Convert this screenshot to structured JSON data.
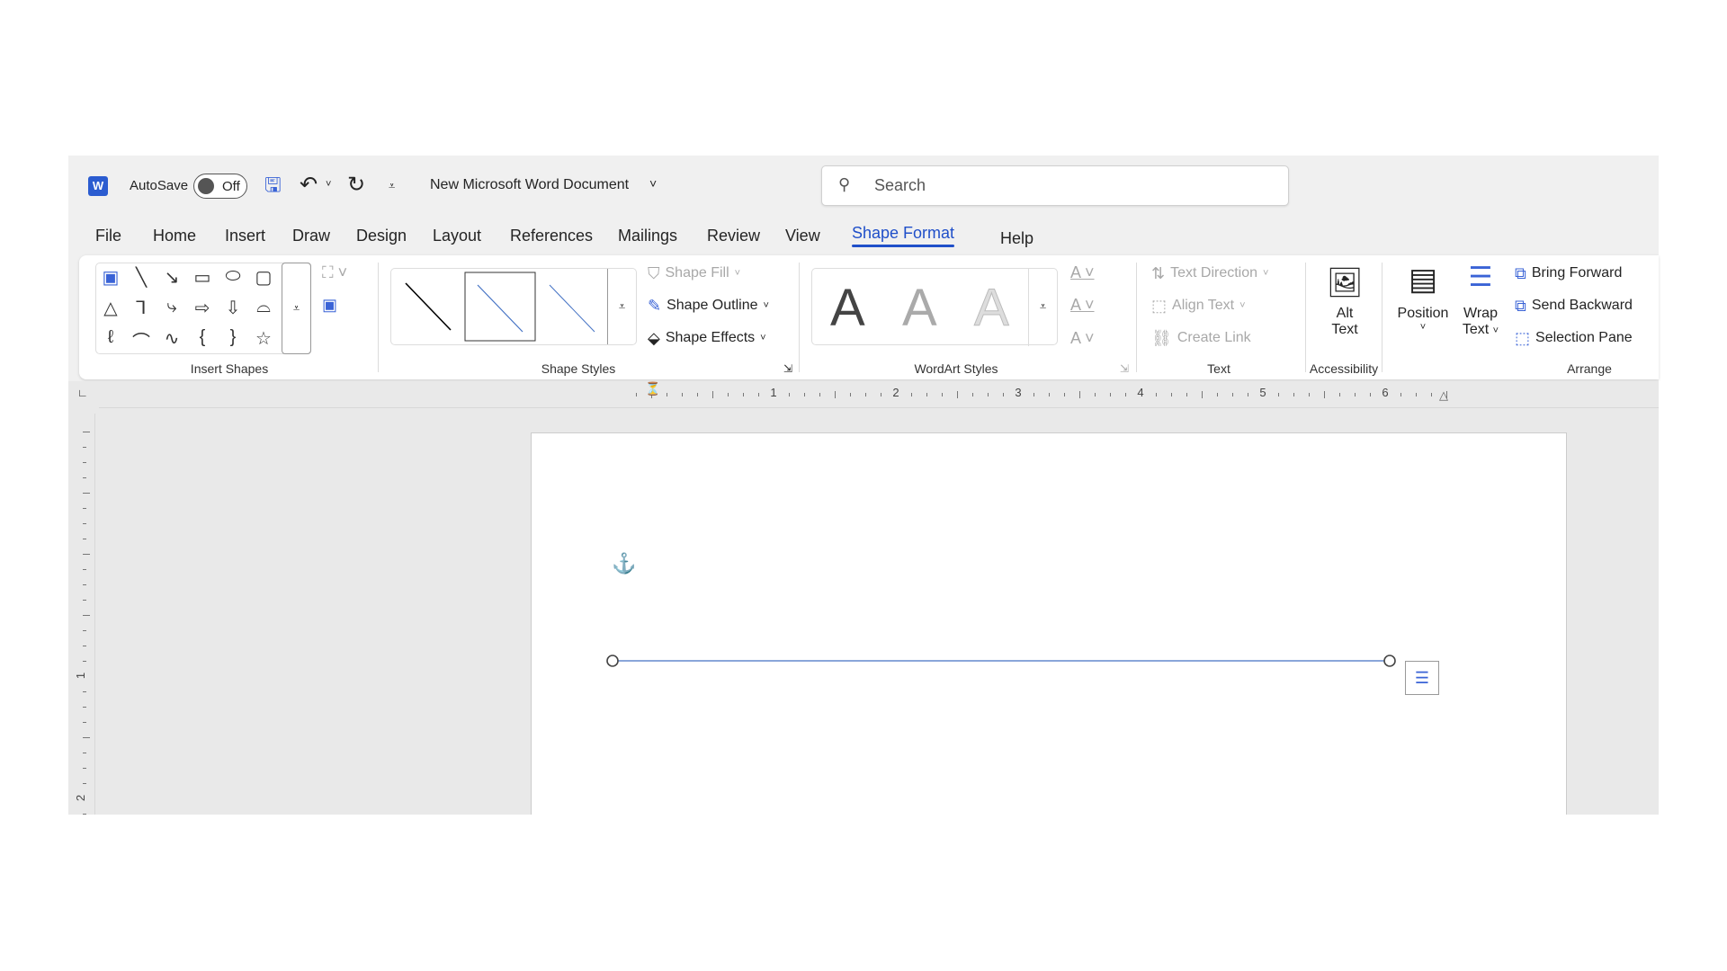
{
  "titlebar": {
    "autosave_label": "AutoSave",
    "autosave_state": "Off",
    "doc_title": "New Microsoft Word Document",
    "search_placeholder": "Search"
  },
  "tabs": [
    {
      "label": "File"
    },
    {
      "label": "Home"
    },
    {
      "label": "Insert"
    },
    {
      "label": "Draw"
    },
    {
      "label": "Design"
    },
    {
      "label": "Layout"
    },
    {
      "label": "References"
    },
    {
      "label": "Mailings"
    },
    {
      "label": "Review"
    },
    {
      "label": "View"
    },
    {
      "label": "Shape Format",
      "active": true
    },
    {
      "label": "Help"
    }
  ],
  "ribbon": {
    "insert_shapes": {
      "label": "Insert Shapes",
      "shapes": [
        "▣",
        "╲",
        "↘",
        "▭",
        "⬭",
        "▢",
        "△",
        "⅂",
        "⤷",
        "⇨",
        "⇩",
        "⌓",
        "ℓ",
        "⌒",
        "∿",
        "{",
        "}",
        "☆"
      ]
    },
    "shape_styles": {
      "label": "Shape Styles",
      "fill": "Shape Fill",
      "outline": "Shape Outline",
      "effects": "Shape Effects"
    },
    "wordart": {
      "label": "WordArt Styles",
      "letter": "A"
    },
    "text": {
      "label": "Text",
      "direction": "Text Direction",
      "align": "Align Text",
      "link": "Create Link"
    },
    "accessibility": {
      "label": "Accessibility",
      "alt1": "Alt",
      "alt2": "Text"
    },
    "arrange": {
      "label": "Arrange",
      "position": "Position",
      "wrap1": "Wrap",
      "wrap2": "Text",
      "bring_forward": "Bring Forward",
      "send_backward": "Send Backward",
      "selection_pane": "Selection Pane"
    }
  },
  "ruler": {
    "h_labels": [
      "1",
      "2",
      "3",
      "4",
      "5",
      "6"
    ],
    "v_labels": [
      "1",
      "2"
    ]
  },
  "colors": {
    "accent": "#1f4fc9",
    "shape_line": "#4472c4"
  }
}
